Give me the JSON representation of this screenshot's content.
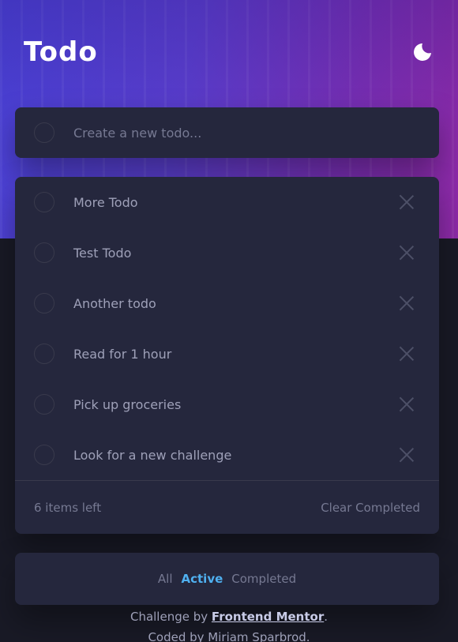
{
  "header": {
    "title": "Todo",
    "theme_toggle_icon": "moon-icon"
  },
  "new_todo": {
    "placeholder": "Create a new todo..."
  },
  "todos": [
    {
      "text": "More Todo",
      "completed": false
    },
    {
      "text": "Test Todo",
      "completed": false
    },
    {
      "text": "Another todo",
      "completed": false
    },
    {
      "text": "Read for 1 hour",
      "completed": false
    },
    {
      "text": "Pick up groceries",
      "completed": false
    },
    {
      "text": "Look for a new challenge",
      "completed": false
    }
  ],
  "footer": {
    "items_left": "6 items left",
    "clear_completed": "Clear Completed"
  },
  "filters": {
    "all": "All",
    "active": "Active",
    "completed": "Completed",
    "selected": "Active"
  },
  "attribution": {
    "challenge_prefix": "Challenge by",
    "challenge_link": "Frontend Mentor",
    "challenge_suffix": ".",
    "coded_by": "Coded by Miriam Sparbrod."
  },
  "colors": {
    "background": "#191a26",
    "card": "#25273d",
    "active_filter": "#4fb0f0",
    "hero_start": "#4a42d8",
    "hero_end": "#8f2aa8"
  }
}
